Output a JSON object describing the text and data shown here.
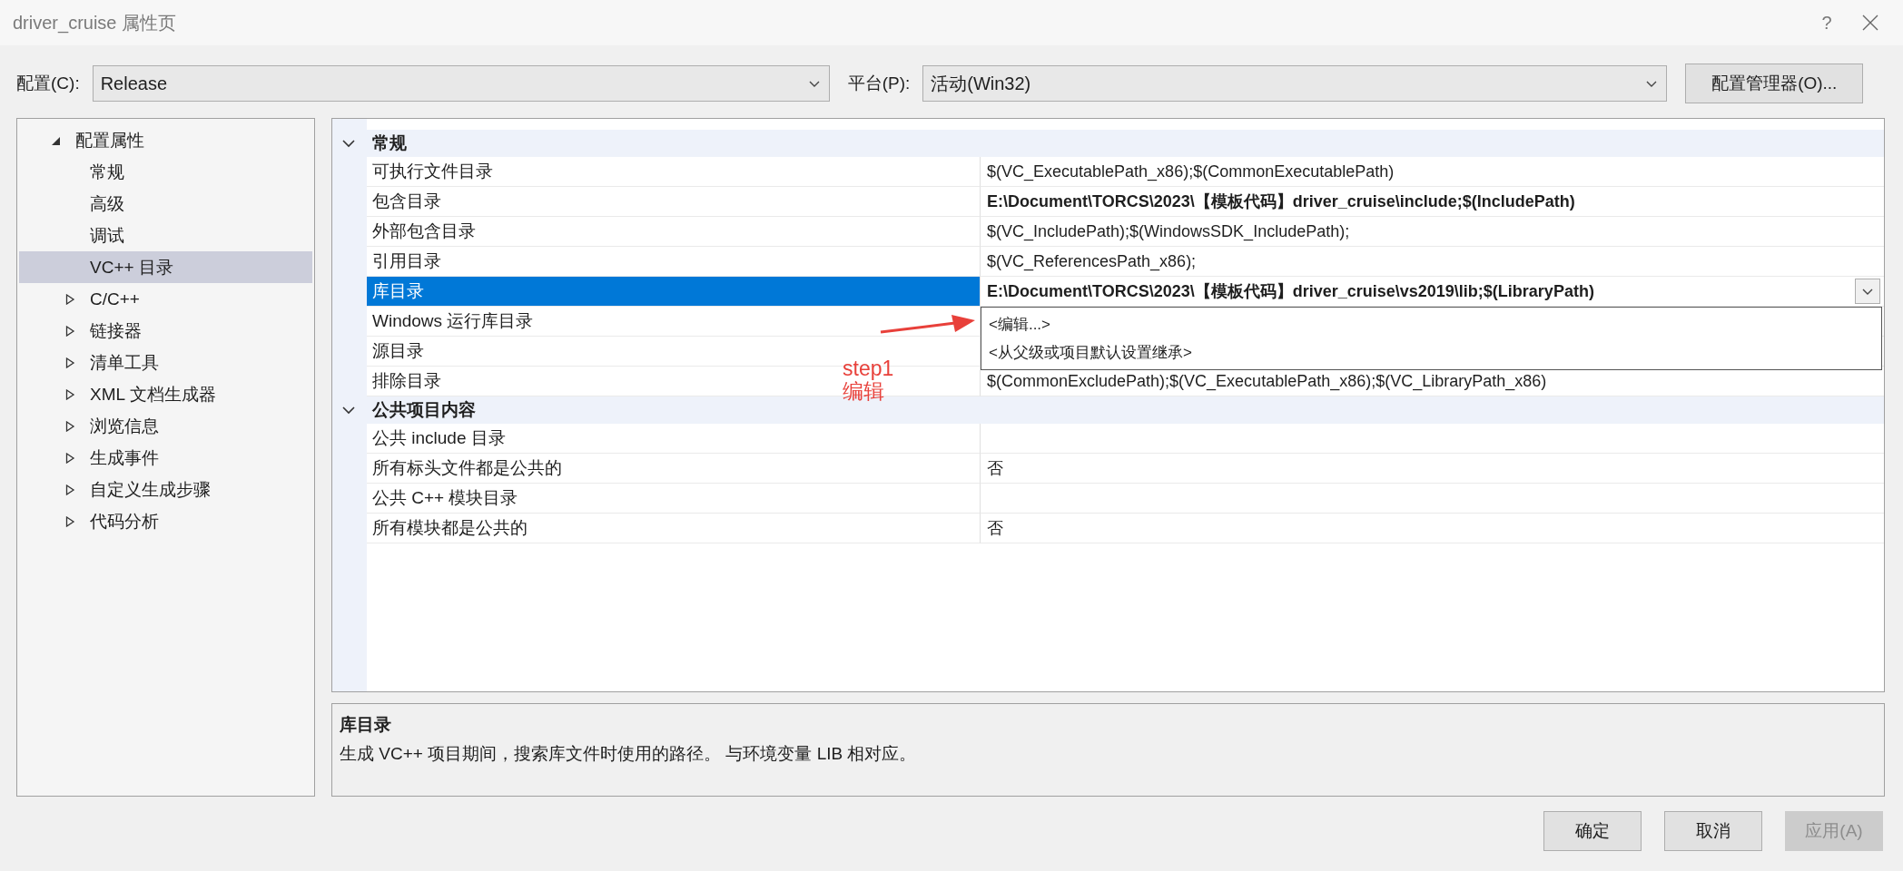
{
  "window": {
    "title": "driver_cruise 属性页",
    "help": "?"
  },
  "toolbar": {
    "config": {
      "label": "配置(C):",
      "value": "Release"
    },
    "platform": {
      "label": "平台(P):",
      "value": "活动(Win32)"
    },
    "manager_button": "配置管理器(O)..."
  },
  "tree": [
    {
      "label": "配置属性",
      "expanded": true,
      "selected": false,
      "children": [
        {
          "label": "常规",
          "selected": false
        },
        {
          "label": "高级",
          "selected": false
        },
        {
          "label": "调试",
          "selected": false
        },
        {
          "label": "VC++ 目录",
          "selected": true
        },
        {
          "label": "C/C++",
          "selected": false,
          "expanded": false
        },
        {
          "label": "链接器",
          "selected": false,
          "expanded": false
        },
        {
          "label": "清单工具",
          "selected": false,
          "expanded": false
        },
        {
          "label": "XML 文档生成器",
          "selected": false,
          "expanded": false
        },
        {
          "label": "浏览信息",
          "selected": false,
          "expanded": false
        },
        {
          "label": "生成事件",
          "selected": false,
          "expanded": false
        },
        {
          "label": "自定义生成步骤",
          "selected": false,
          "expanded": false
        },
        {
          "label": "代码分析",
          "selected": false,
          "expanded": false
        }
      ]
    }
  ],
  "grid": {
    "sections": [
      {
        "title": "常规",
        "expanded": true,
        "rows": [
          {
            "name": "可执行文件目录",
            "value": "$(VC_ExecutablePath_x86);$(CommonExecutablePath)",
            "bold": false,
            "selected": false
          },
          {
            "name": "包含目录",
            "value": "E:\\Document\\TORCS\\2023\\【模板代码】driver_cruise\\include;$(IncludePath)",
            "bold": true,
            "selected": false
          },
          {
            "name": "外部包含目录",
            "value": "$(VC_IncludePath);$(WindowsSDK_IncludePath);",
            "bold": false,
            "selected": false
          },
          {
            "name": "引用目录",
            "value": "$(VC_ReferencesPath_x86);",
            "bold": false,
            "selected": false
          },
          {
            "name": "库目录",
            "value": "E:\\Document\\TORCS\\2023\\【模板代码】driver_cruise\\vs2019\\lib;$(LibraryPath)",
            "bold": true,
            "selected": true
          },
          {
            "name": "Windows 运行库目录",
            "bold": false,
            "selected": false
          },
          {
            "name": "源目录",
            "bold": false,
            "selected": false
          },
          {
            "name": "排除目录",
            "value": "$(CommonExcludePath);$(VC_ExecutablePath_x86);$(VC_LibraryPath_x86)",
            "bold": false,
            "selected": false
          }
        ]
      },
      {
        "title": "公共项目内容",
        "expanded": true,
        "rows": [
          {
            "name": "公共 include 目录",
            "bold": false,
            "selected": false
          },
          {
            "name": "所有标头文件都是公共的",
            "value": "否",
            "bold": false,
            "selected": false
          },
          {
            "name": "公共 C++ 模块目录",
            "bold": false,
            "selected": false
          },
          {
            "name": "所有模块都是公共的",
            "value": "否",
            "bold": false,
            "selected": false
          }
        ]
      }
    ],
    "dropdown_options": [
      "<编辑...>",
      "<从父级或项目默认设置继承>"
    ]
  },
  "annotation": {
    "lines": [
      "step1",
      "编辑"
    ]
  },
  "description": {
    "title": "库目录",
    "text": "生成 VC++ 项目期间，搜索库文件时使用的路径。 与环境变量 LIB 相对应。"
  },
  "buttons": [
    {
      "label": "确定",
      "disabled": false
    },
    {
      "label": "取消",
      "disabled": false
    },
    {
      "label": "应用(A)",
      "disabled": true
    }
  ]
}
